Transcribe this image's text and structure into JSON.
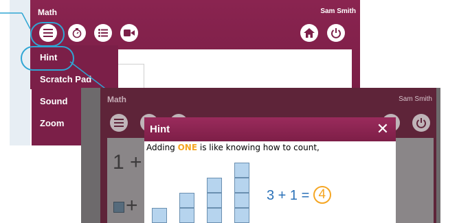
{
  "background_app": {
    "title": "Math",
    "user": "Sam Smith",
    "toolbar_icons": [
      "menu-icon",
      "timer-icon",
      "list-icon",
      "video-icon"
    ],
    "right_icons": [
      "home-icon",
      "power-icon"
    ],
    "menu": {
      "items": [
        {
          "label": "Hint"
        },
        {
          "label": "Scratch Pad"
        },
        {
          "label": "Sound"
        },
        {
          "label": "Zoom"
        }
      ]
    }
  },
  "foreground_app": {
    "title": "Math",
    "user": "Sam Smith",
    "partial_text_1": "1 +",
    "partial_text_2": "+"
  },
  "hint_dialog": {
    "title": "Hint",
    "close_symbol": "✕",
    "text_before": "Adding ",
    "text_highlight": "ONE",
    "text_after": " is like knowing how to count,",
    "equation": "3 + 1 =",
    "answer": "4",
    "column_heights": [
      1,
      2,
      3,
      4
    ]
  },
  "colors": {
    "header": "#7b1f48",
    "callout": "#2fa6d4",
    "highlight": "#f5a623",
    "equation": "#2a71b8",
    "cube_fill": "#b6d4ee"
  }
}
